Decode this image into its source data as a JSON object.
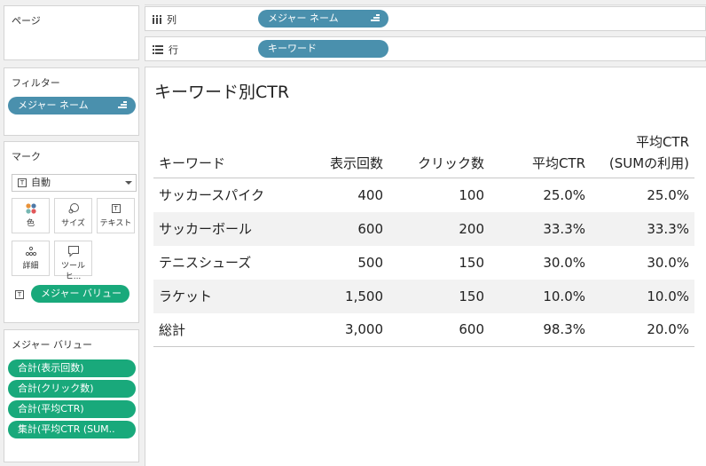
{
  "pages_panel": {
    "title": "ページ"
  },
  "columns_shelf": {
    "icon": "columns-icon",
    "label": "列",
    "pill": "メジャー ネーム"
  },
  "rows_shelf": {
    "icon": "rows-icon",
    "label": "行",
    "pill": "キーワード"
  },
  "filters_panel": {
    "title": "フィルター",
    "pill": "メジャー ネーム"
  },
  "marks_panel": {
    "title": "マーク",
    "mark_type": "自動",
    "buttons": [
      {
        "label": "色",
        "icon": "color-icon"
      },
      {
        "label": "サイズ",
        "icon": "size-icon"
      },
      {
        "label": "テキスト",
        "icon": "text-icon"
      },
      {
        "label": "詳細",
        "icon": "detail-icon"
      },
      {
        "label": "ツールヒ...",
        "icon": "tooltip-icon"
      }
    ],
    "text_pill": "メジャー バリュー"
  },
  "measure_values_panel": {
    "title": "メジャー バリュー",
    "items": [
      "合計(表示回数)",
      "合計(クリック数)",
      "合計(平均CTR)",
      "集計(平均CTR (SUM.."
    ]
  },
  "view": {
    "title": "キーワード別CTR",
    "headers": [
      "キーワード",
      "表示回数",
      "クリック数",
      "平均CTR",
      "平均CTR",
      "(SUMの利用)"
    ],
    "rows": [
      [
        "サッカースパイク",
        "400",
        "100",
        "25.0%",
        "25.0%"
      ],
      [
        "サッカーボール",
        "600",
        "200",
        "33.3%",
        "33.3%"
      ],
      [
        "テニスシューズ",
        "500",
        "150",
        "30.0%",
        "30.0%"
      ],
      [
        "ラケット",
        "1,500",
        "150",
        "10.0%",
        "10.0%"
      ]
    ],
    "total": [
      "総計",
      "3,000",
      "600",
      "98.3%",
      "20.0%"
    ]
  },
  "colors": {
    "blue_pill": "#4a90ad",
    "green_pill": "#19a97b"
  }
}
